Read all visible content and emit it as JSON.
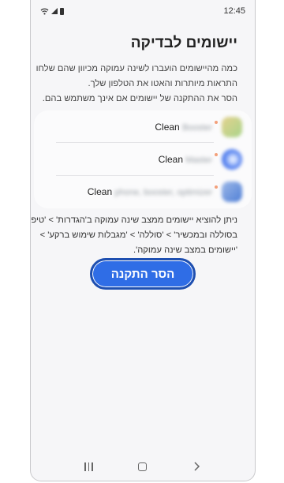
{
  "status_bar": {
    "time": "12:45",
    "wifi_icon": "wifi-icon",
    "signal_icon": "signal-icon",
    "battery_icon": "battery-icon"
  },
  "dialog": {
    "title": "יישומים לבדיקה",
    "description_lines": [
      "כמה מהיישומים הועברו לשינה עמוקה מכיוון שהם שלחו",
      "התראות מיותרות והאטו את הטלפון שלך.",
      "הסר את ההתקנה של יישומים אם אינך משתמש בהם."
    ],
    "apps": [
      {
        "prefix": "Clean",
        "blurred": "Booster",
        "icon_colors": [
          "#a9d48a",
          "#e4d28e"
        ]
      },
      {
        "prefix": "Clean",
        "blurred": "Master",
        "icon_colors": [
          "#3d6bea",
          "#a8c2ff"
        ]
      },
      {
        "prefix": "Clean",
        "blurred": "phone, booster, optimizer",
        "icon_colors": [
          "#4f7fd6",
          "#9db8e8"
        ]
      }
    ],
    "note_lines": [
      "ניתן להוציא יישומים ממצב שינה עמוקה ב'הגדרות' > 'טיפול",
      "בסוללה ובמכשיר' > 'סוללה' > 'מגבלות שימוש ברקע' >",
      "'יישומים במצב שינה עמוקה'."
    ],
    "uninstall_label": "הסר התקנה",
    "accent_color": "#2f6de6"
  },
  "nav_bar": {
    "recents_icon": "recents-icon",
    "home_icon": "home-icon",
    "back_icon": "back-icon"
  }
}
